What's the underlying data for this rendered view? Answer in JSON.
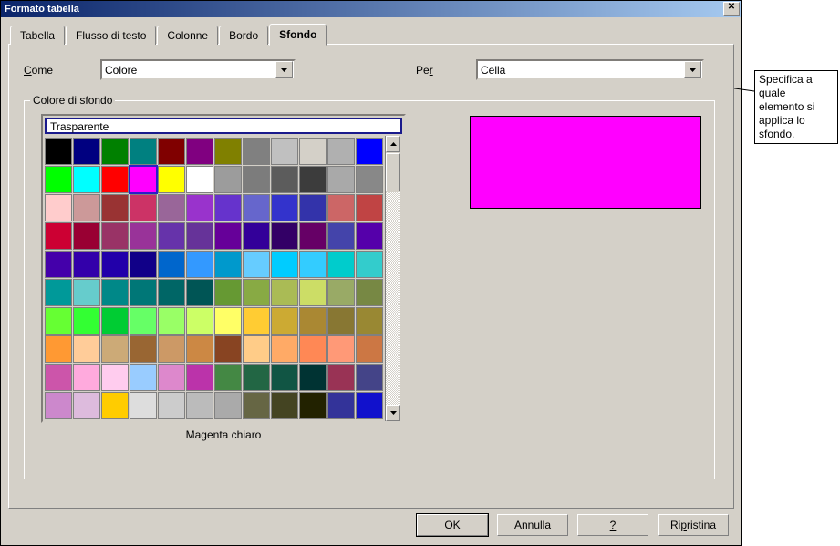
{
  "window": {
    "title": "Formato tabella"
  },
  "tabs": {
    "items": [
      {
        "label": "Tabella"
      },
      {
        "label": "Flusso di testo"
      },
      {
        "label": "Colonne"
      },
      {
        "label": "Bordo"
      },
      {
        "label": "Sfondo"
      }
    ],
    "active_index": 4
  },
  "fields": {
    "come": {
      "label_pre": "",
      "accesskey": "C",
      "label_post": "ome",
      "value": "Colore"
    },
    "per": {
      "label_pre": "Pe",
      "accesskey": "r",
      "label_post": "",
      "value": "Cella"
    }
  },
  "group": {
    "title": "Colore di sfondo",
    "transparent_label": "Trasparente",
    "selected_color_name": "Magenta chiaro",
    "preview_color": "#ff00ff"
  },
  "palette": {
    "selected_index": 15,
    "rows": [
      [
        "#000000",
        "#000080",
        "#008000",
        "#008080",
        "#800000",
        "#800080",
        "#808000",
        "#808080",
        "#c0c0c0",
        "#d4d0c8",
        "#b0b0b0",
        "#0000ff"
      ],
      [
        "#00ff00",
        "#00ffff",
        "#ff0000",
        "#ff00ff",
        "#ffff00",
        "#ffffff",
        "#9c9c9c",
        "#7c7c7c",
        "#5c5c5c",
        "#3c3c3c",
        "#a9a9a9",
        "#888888"
      ],
      [
        "#ffcccc",
        "#cc9999",
        "#993333",
        "#cc3366",
        "#996699",
        "#9933cc",
        "#6633cc",
        "#6666cc",
        "#3333cc",
        "#3333aa",
        "#cc6666",
        "#c04444"
      ],
      [
        "#cc0033",
        "#990033",
        "#993366",
        "#993399",
        "#6633aa",
        "#663399",
        "#660099",
        "#330099",
        "#330066",
        "#660066",
        "#4444aa",
        "#5500aa"
      ],
      [
        "#4400aa",
        "#3300aa",
        "#2200aa",
        "#110088",
        "#0066cc",
        "#3399ff",
        "#0099cc",
        "#66ccff",
        "#00ccff",
        "#33ccff",
        "#00cccc",
        "#33cccc"
      ],
      [
        "#009999",
        "#66cccc",
        "#008888",
        "#007777",
        "#006666",
        "#005555",
        "#669933",
        "#88aa44",
        "#aabb55",
        "#ccdd66",
        "#99aa66",
        "#778844"
      ],
      [
        "#66ff33",
        "#33ff33",
        "#00cc33",
        "#66ff66",
        "#99ff66",
        "#ccff66",
        "#ffff66",
        "#ffcc33",
        "#ccaa33",
        "#aa8833",
        "#887733",
        "#998833"
      ],
      [
        "#ff9933",
        "#ffcc99",
        "#ccaa77",
        "#996633",
        "#cc9966",
        "#cc8844",
        "#884422",
        "#ffcc88",
        "#ffaa66",
        "#ff8855",
        "#ff9977",
        "#cc7744"
      ],
      [
        "#cc55aa",
        "#ffaadd",
        "#ffccee",
        "#99ccff",
        "#dd88cc",
        "#bb33aa",
        "#448844",
        "#226644",
        "#115544",
        "#003333",
        "#993355",
        "#444488"
      ],
      [
        "#cc88cc",
        "#ddbbdd",
        "#ffcc00",
        "#dddddd",
        "#cccccc",
        "#bbbbbb",
        "#aaaaaa",
        "#666644",
        "#444422",
        "#222200",
        "#333399",
        "#1111cc"
      ]
    ]
  },
  "buttons": {
    "ok": "OK",
    "cancel": "Annulla",
    "help_char": "?",
    "reset_pre": "Ri",
    "reset_access": "p",
    "reset_post": "ristina"
  },
  "callout": {
    "text": "Specifica a quale elemento si applica lo sfondo."
  }
}
